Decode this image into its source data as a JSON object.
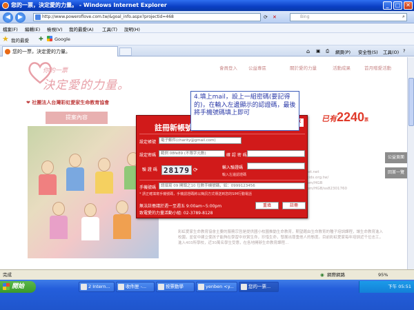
{
  "window": {
    "title": "您的一票，決定愛的力量。 - Windows Internet Explorer"
  },
  "address": {
    "url": "http://www.poweroflove.com.tw/&goal_info.aspx?projectid=468",
    "search_placeholder": "Bing"
  },
  "menu": [
    "檔案(F)",
    "編輯(E)",
    "檢視(V)",
    "我的最愛(A)",
    "工具(T)",
    "說明(H)"
  ],
  "favorites": {
    "label": "我的最愛",
    "items": [
      "Google"
    ]
  },
  "tab": {
    "title": "您的一票，決定愛的力量。"
  },
  "toolbar": {
    "page": "網頁(P)",
    "safety": "安全性(S)",
    "tools": "工具(O)",
    "help": "?"
  },
  "site": {
    "logo_small": "你的一票",
    "logo_text": "決定愛的力量。",
    "nav": [
      "會員登入",
      "公益專區",
      "關於愛的力量",
      "活動成果",
      "首月贈愛活動"
    ],
    "subbrand": "❤ 社團法人台灣彩虹愛家生命教育協會",
    "tab_propose": "提案內容",
    "count_prefix": "已有",
    "count": "2240",
    "count_suffix": "票",
    "side_buttons": [
      "公益頁面",
      "回首一覽"
    ],
    "page_text": "02-28012993\nalpha@ms32.hinet.net\n...rainbowfamilykids.org.tw/\nwww.facebook.com/HGB\nwww.facebook.com/HGB/ss82301760",
    "body_text": "彩虹愛家生命教育協會主要的服務宗旨是提供國小校園推動生命教育，期望藉由生命教育的種子培訓課程，讓生命教育進入校園，並從中建立使孩子能夠在學習中欣賞生命，珍惜生命，發展出尊重他人的態度。目前彩虹愛家每年培訓近千位志工，進入403所學校，近30萬名學生受惠，在各地開辦生命教育課程..."
  },
  "dialog": {
    "title": "註冊新帳號",
    "close": "✕",
    "labels": {
      "account": "設定帳號",
      "password": "設定密碼",
      "confirm": "確 認 密 碼",
      "verify": "驗 證 碼",
      "verify_input": "輸入驗證碼",
      "phone": "手機號碼"
    },
    "account_placeholder": "電子郵件(charity@gmail.com)",
    "password_placeholder": "範例 08fe89 (不限字元數)",
    "captcha": "28179",
    "verify_note": "輸入左邊認證碼",
    "phone_placeholder": "請填寫 09 開頭之10 位數手機號碼，如：0999123456",
    "phone_note": "* 請正確填寫手機號碼，手機認證碼將以簡訊方式傳送到您的SIM行動電話",
    "service_hours": "無法註冊請於週一至週五 9:00am~5:00pm",
    "service_contact": "致電愛的力量活動小組: 02-3789-8128",
    "reset_button": "重填",
    "submit_button": "註冊"
  },
  "callout": {
    "text": "4.填上mail，設上一組密碼(要記得的)，在輸入左邊顯示的認證碼，最後將手機號碼填上即可"
  },
  "status": {
    "left": "完成",
    "zone": "網際網路",
    "zoom": "95%"
  },
  "taskbar": {
    "start": "開始",
    "tasks": [
      "2 Intern...",
      "收件匣 -...",
      "按票動學",
      "yenben <y...",
      "您的一票..."
    ],
    "clock": "下午 05:51"
  }
}
